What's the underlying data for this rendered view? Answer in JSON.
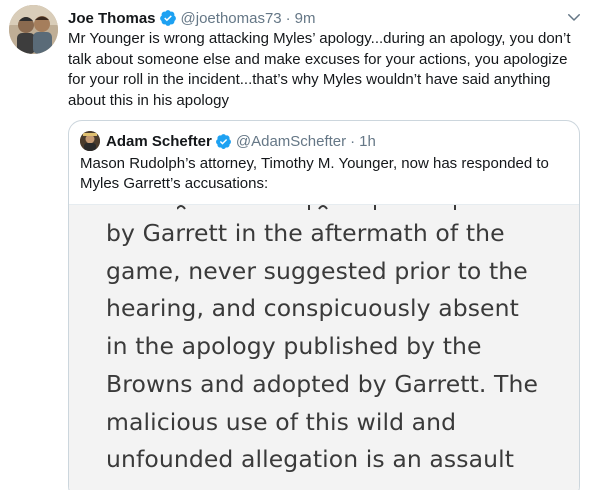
{
  "tweet": {
    "author_name": "Joe Thomas",
    "author_handle": "@joethomas73",
    "separator": "·",
    "time": "9m",
    "text": "Mr Younger is wrong attacking Myles’ apology...during an apology, you don’t talk about someone else and make excuses for your actions, you apologize for your roll in the incident...that’s why Myles wouldn’t have said anything about this in his apology",
    "verified_icon": "verified-badge-icon",
    "menu_icon": "chevron-down-icon"
  },
  "quoted_tweet": {
    "author_name": "Adam Schefter",
    "author_handle": "@AdamSchefter",
    "separator": "·",
    "time": "1h",
    "text": "Mason Rudolph’s attorney, Timothy M. Younger, now has responded to Myles Garrett’s accusations:",
    "image_text_lines": [
      "by Garrett in the aftermath of the",
      "game, never suggested prior to the",
      "hearing, and conspicuously absent",
      "in the apology published by the",
      "Browns and adopted by Garrett. The",
      "malicious use of this wild and",
      "unfounded allegation is an assault"
    ]
  },
  "colors": {
    "verified_blue": "#1da1f2",
    "secondary_text": "#657786",
    "border": "#ccd6dd"
  }
}
